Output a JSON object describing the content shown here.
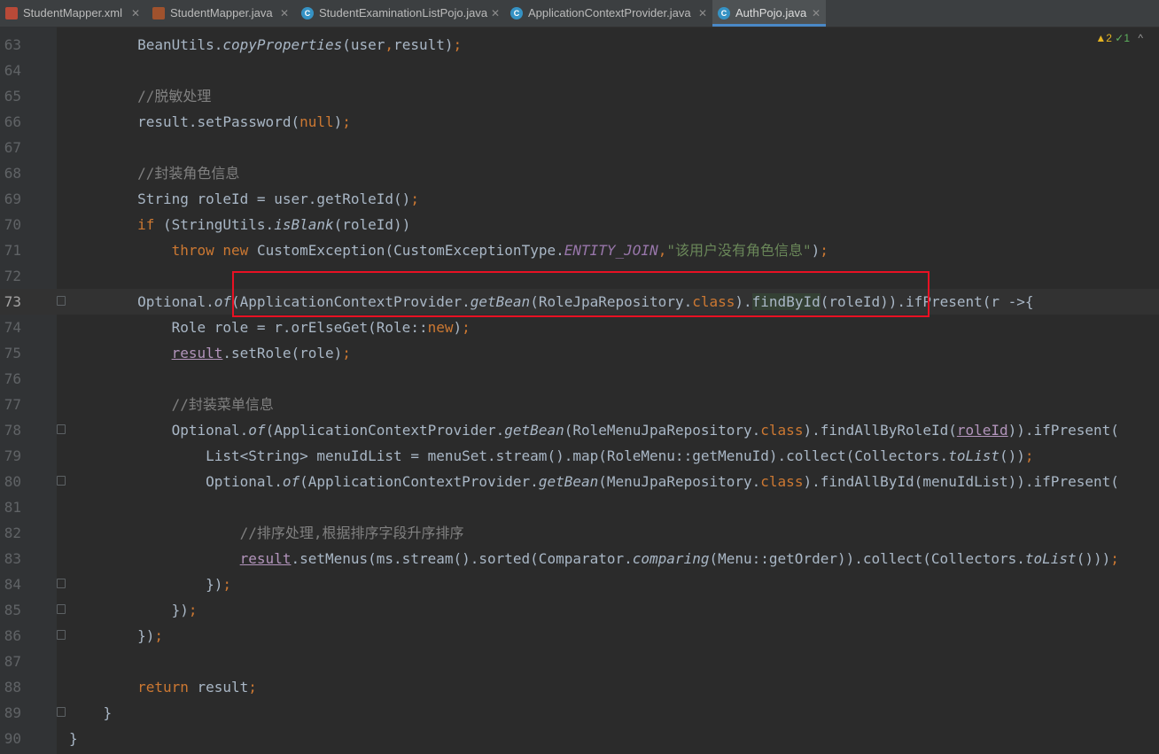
{
  "tabs": [
    {
      "label": "StudentMapper.xml",
      "icon": "xml-file-icon"
    },
    {
      "label": "StudentMapper.java",
      "icon": "java-file-icon"
    },
    {
      "label": "StudentExaminationListPojo.java",
      "icon": "class-icon"
    },
    {
      "label": "ApplicationContextProvider.java",
      "icon": "class-icon"
    },
    {
      "label": "AuthPojo.java",
      "icon": "class-icon",
      "active": true
    }
  ],
  "inspection": {
    "warnings": "▲2",
    "ok": "✓1",
    "chevron": "^"
  },
  "lines": [
    {
      "n": "63",
      "t": "        BeanUtils.copyProperties(user,result);"
    },
    {
      "n": "64",
      "t": ""
    },
    {
      "n": "65",
      "t": "        //脱敏处理"
    },
    {
      "n": "66",
      "t": "        result.setPassword(null);"
    },
    {
      "n": "67",
      "t": ""
    },
    {
      "n": "68",
      "t": "        //封装角色信息"
    },
    {
      "n": "69",
      "t": "        String roleId = user.getRoleId();"
    },
    {
      "n": "70",
      "t": "        if (StringUtils.isBlank(roleId))"
    },
    {
      "n": "71",
      "t": "            throw new CustomException(CustomExceptionType.ENTITY_JOIN,\"该用户没有角色信息\");"
    },
    {
      "n": "72",
      "t": ""
    },
    {
      "n": "73",
      "t": "        Optional.of(ApplicationContextProvider.getBean(RoleJpaRepository.class).findById(roleId)).ifPresent(r ->{"
    },
    {
      "n": "74",
      "t": "            Role role = r.orElseGet(Role::new);"
    },
    {
      "n": "75",
      "t": "            result.setRole(role);"
    },
    {
      "n": "76",
      "t": ""
    },
    {
      "n": "77",
      "t": "            //封装菜单信息"
    },
    {
      "n": "78",
      "t": "            Optional.of(ApplicationContextProvider.getBean(RoleMenuJpaRepository.class).findAllByRoleId(roleId)).ifPresent("
    },
    {
      "n": "79",
      "t": "                List<String> menuIdList = menuSet.stream().map(RoleMenu::getMenuId).collect(Collectors.toList());"
    },
    {
      "n": "80",
      "t": "                Optional.of(ApplicationContextProvider.getBean(MenuJpaRepository.class).findAllById(menuIdList)).ifPresent("
    },
    {
      "n": "81",
      "t": ""
    },
    {
      "n": "82",
      "t": "                    //排序处理,根据排序字段升序排序"
    },
    {
      "n": "83",
      "t": "                    result.setMenus(ms.stream().sorted(Comparator.comparing(Menu::getOrder)).collect(Collectors.toList()));"
    },
    {
      "n": "84",
      "t": "                });"
    },
    {
      "n": "85",
      "t": "            });"
    },
    {
      "n": "86",
      "t": "        });"
    },
    {
      "n": "87",
      "t": ""
    },
    {
      "n": "88",
      "t": "        return result;"
    },
    {
      "n": "89",
      "t": "    }"
    },
    {
      "n": "90",
      "t": "}"
    }
  ],
  "colors": {
    "accent_tab": "#4a88c7",
    "highlight_box": "#e81123"
  }
}
